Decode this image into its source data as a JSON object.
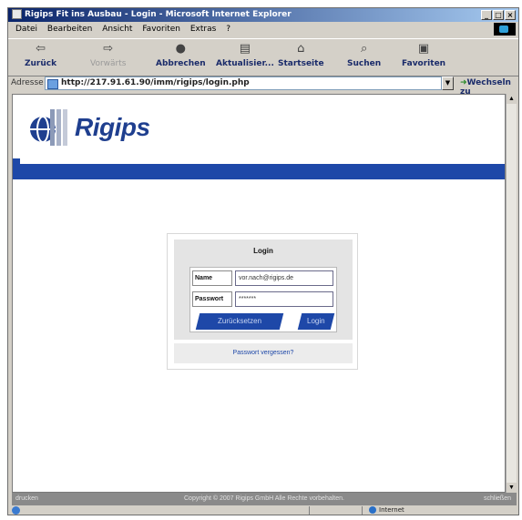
{
  "window": {
    "title": "Rigips Fit ins Ausbau - Login - Microsoft Internet Explorer",
    "buttons": {
      "minimize": "_",
      "maximize": "□",
      "close": "×"
    }
  },
  "menu": [
    "Datei",
    "Bearbeiten",
    "Ansicht",
    "Favoriten",
    "Extras",
    "?"
  ],
  "toolbar": {
    "back": "Zurück",
    "forward": "Vorwärts",
    "stop": "Abbrechen",
    "refresh": "Aktualisier...",
    "home": "Startseite",
    "search": "Suchen",
    "favorites": "Favoriten"
  },
  "address": {
    "label": "Adresse",
    "url": "http://217.91.61.90/imm/rigips/login.php",
    "go": "Wechseln zu"
  },
  "page": {
    "logo_text": "Rigips",
    "login": {
      "title": "Login",
      "name_label": "Name",
      "name_value": "vor.nach@rigips.de",
      "password_label": "Passwort",
      "password_value": "*******",
      "reset_button": "Zurücksetzen",
      "login_button": "Login",
      "forgot_link": "Passwort vergessen?"
    },
    "footer": {
      "print": "drucken",
      "copyright": "Copyright © 2007 Rigips GmbH Alle Rechte vorbehalten.",
      "close": "schließen"
    }
  },
  "status": {
    "zone": "Internet"
  },
  "colors": {
    "brand_blue": "#1e48a8",
    "title_blue": "#0a246a"
  }
}
